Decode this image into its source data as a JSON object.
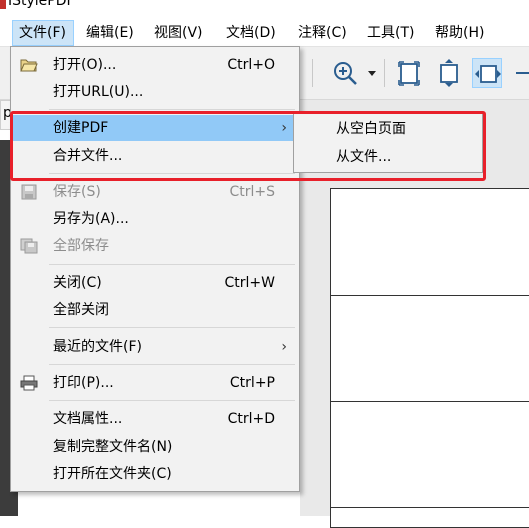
{
  "app": {
    "title": "IStylePDF"
  },
  "menubar": {
    "items": [
      {
        "label": "文件(F)",
        "active": true
      },
      {
        "label": "编辑(E)"
      },
      {
        "label": "视图(V)"
      },
      {
        "label": "文档(D)"
      },
      {
        "label": "注释(C)"
      },
      {
        "label": "工具(T)"
      },
      {
        "label": "帮助(H)"
      }
    ]
  },
  "toolbar": {
    "icons": [
      "zoom-in-icon",
      "dropdown-arrow-icon",
      "fit-page-icon",
      "fit-height-icon",
      "fit-width-icon",
      "more-icon"
    ]
  },
  "side_tab": {
    "label": "p"
  },
  "file_menu": {
    "items": [
      {
        "label": "打开(O)...",
        "shortcut": "Ctrl+O",
        "icon": "folder-open-icon"
      },
      {
        "label": "打开URL(U)...",
        "shortcut": ""
      },
      {
        "label": "创建PDF",
        "shortcut": "",
        "submenu": true,
        "highlighted": true
      },
      {
        "label": "合并文件...",
        "shortcut": ""
      },
      {
        "label": "保存(S)",
        "shortcut": "Ctrl+S",
        "disabled": true,
        "icon": "save-icon"
      },
      {
        "label": "另存为(A)...",
        "shortcut": ""
      },
      {
        "label": "全部保存",
        "shortcut": "",
        "disabled": true,
        "icon": "save-all-icon"
      },
      {
        "label": "关闭(C)",
        "shortcut": "Ctrl+W"
      },
      {
        "label": "全部关闭",
        "shortcut": ""
      },
      {
        "label": "最近的文件(F)",
        "shortcut": "",
        "submenu": true
      },
      {
        "label": "打印(P)...",
        "shortcut": "Ctrl+P",
        "icon": "printer-icon"
      },
      {
        "label": "文档属性...",
        "shortcut": "Ctrl+D"
      },
      {
        "label": "复制完整文件名(N)",
        "shortcut": ""
      },
      {
        "label": "打开所在文件夹(C)",
        "shortcut": ""
      }
    ],
    "submenu_arrow": "›"
  },
  "create_pdf_submenu": {
    "items": [
      {
        "label": "从空白页面"
      },
      {
        "label": "从文件..."
      }
    ]
  },
  "colors": {
    "highlight": "#91c9f7",
    "menu_bg": "#f2f2f2",
    "annotation_red": "#e8202a",
    "active_menu": "#cce4f7"
  }
}
